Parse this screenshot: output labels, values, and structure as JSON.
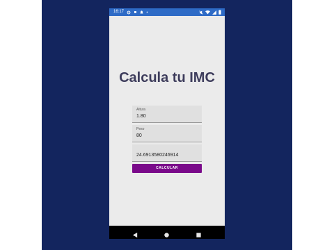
{
  "status_bar": {
    "time": "16:17",
    "left_icons": [
      "gear-icon",
      "dot-icon",
      "bell-icon"
    ],
    "right_icons": [
      "mute-icon",
      "wifi-icon",
      "signal-icon",
      "battery-icon"
    ]
  },
  "title": "Calcula tu IMC",
  "fields": {
    "altura": {
      "label": "Altura",
      "value": "1.80"
    },
    "peso": {
      "label": "Peso",
      "value": "80"
    },
    "result": {
      "value": "24.6913580246914"
    }
  },
  "button": {
    "label": "CALCULAR"
  },
  "nav": {
    "icons": [
      "back-icon",
      "home-icon",
      "recents-icon"
    ]
  },
  "colors": {
    "background": "#13255e",
    "status_bar": "#2e6bc6",
    "title": "#3e3d5c",
    "button": "#7a0a8a"
  }
}
